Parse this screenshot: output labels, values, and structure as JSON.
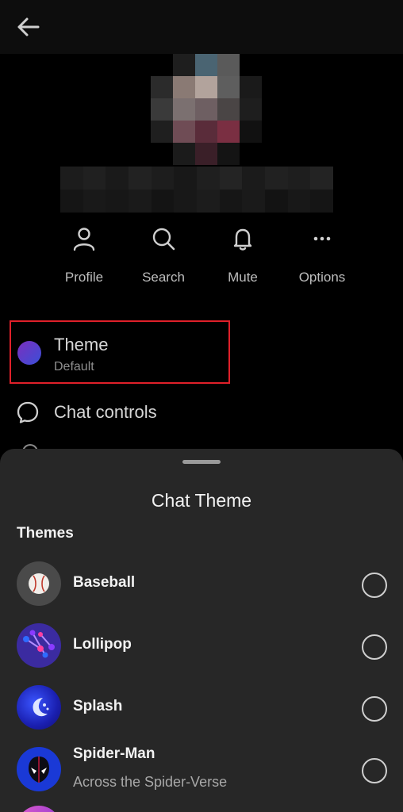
{
  "header": {
    "back_icon": "arrow-left-icon"
  },
  "actions": [
    {
      "label": "Profile",
      "icon": "person-icon"
    },
    {
      "label": "Search",
      "icon": "search-icon"
    },
    {
      "label": "Mute",
      "icon": "bell-icon"
    },
    {
      "label": "Options",
      "icon": "more-horizontal-icon"
    }
  ],
  "settings": {
    "theme": {
      "title": "Theme",
      "subtitle": "Default"
    },
    "chat_controls": {
      "label": "Chat controls"
    }
  },
  "sheet": {
    "title": "Chat Theme",
    "section": "Themes",
    "items": [
      {
        "name": "Baseball",
        "subtitle": ""
      },
      {
        "name": "Lollipop",
        "subtitle": ""
      },
      {
        "name": "Splash",
        "subtitle": ""
      },
      {
        "name": "Spider-Man",
        "subtitle": "Across the Spider-Verse"
      }
    ]
  },
  "colors": {
    "accent_highlight": "#e0202a",
    "sheet_bg": "#272727",
    "background": "#000000"
  }
}
